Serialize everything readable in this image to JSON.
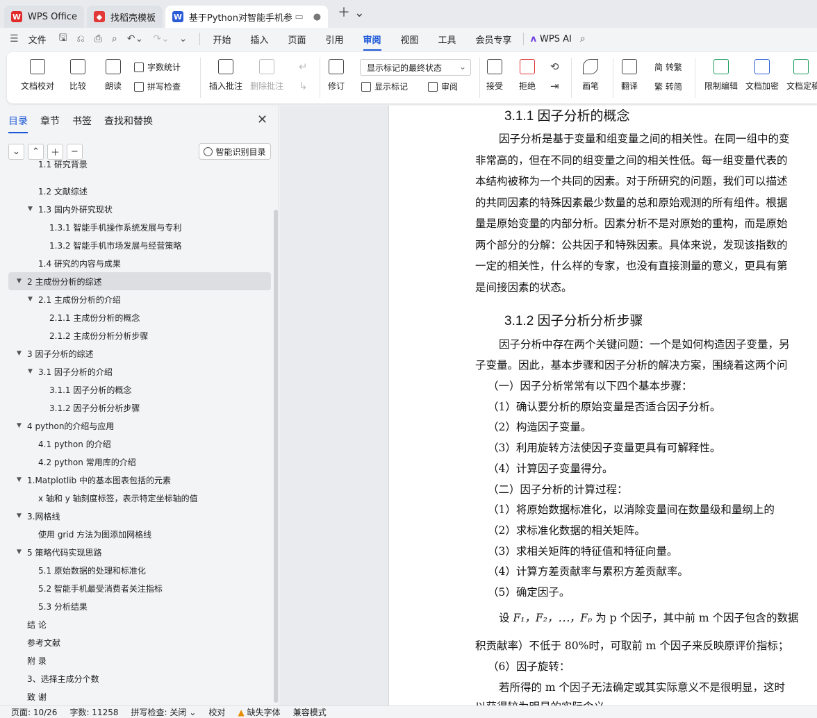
{
  "tabs": [
    {
      "label": "WPS Office",
      "icon": "wps-logo-icon",
      "color": "#e22b2b"
    },
    {
      "label": "找稻壳模板",
      "icon": "docer-icon",
      "color": "#e23838"
    },
    {
      "label": "基于Python对智能手机参数对",
      "icon": "writer-icon",
      "color": "#2a5bd7"
    }
  ],
  "menu": {
    "file": "文件",
    "items": [
      "开始",
      "插入",
      "页面",
      "引用",
      "审阅",
      "视图",
      "工具",
      "会员专享"
    ],
    "active": "审阅",
    "wps_ai": "WPS AI"
  },
  "ribbon": {
    "doc_check": "文档校对",
    "compare": "比较",
    "read_aloud": "朗读",
    "word_count": "字数统计",
    "spell_check": "拼写检查",
    "insert_comment": "插入批注",
    "delete_comment": "删除批注",
    "revise": "修订",
    "markup_display": "显示标记的最终状态",
    "show_markup": "显示标记",
    "review": "审阅",
    "accept": "接受",
    "reject": "拒绝",
    "pen": "画笔",
    "translate": "翻译",
    "to_traditional": "简 转繁",
    "to_simplified": "繁 转简",
    "restrict_edit": "限制编辑",
    "encrypt": "文档加密",
    "finalize": "文档定稿"
  },
  "sidebar": {
    "tabs": [
      "目录",
      "章节",
      "书签",
      "查找和替换"
    ],
    "smart_toc": "智能识别目录",
    "toc": [
      {
        "text": "1.1 研究背景",
        "level": 2,
        "arrow": false,
        "cut": true
      },
      {
        "text": "1.2 文献综述",
        "level": 2,
        "arrow": false
      },
      {
        "text": "1.3 国内外研究现状",
        "level": 2,
        "arrow": true
      },
      {
        "text": "1.3.1 智能手机操作系统发展与专利",
        "level": 3,
        "arrow": false
      },
      {
        "text": "1.3.2 智能手机市场发展与经营策略",
        "level": 3,
        "arrow": false
      },
      {
        "text": "1.4  研究的内容与成果",
        "level": 2,
        "arrow": false
      },
      {
        "text": "2 主成份分析的综述",
        "level": 1,
        "arrow": true,
        "selected": true
      },
      {
        "text": "2.1 主成份分析的介绍",
        "level": 2,
        "arrow": true
      },
      {
        "text": "2.1.1 主成份分析的概念",
        "level": 3,
        "arrow": false
      },
      {
        "text": "2.1.2 主成份分析分析步骤",
        "level": 3,
        "arrow": false
      },
      {
        "text": "3  因子分析的综述",
        "level": 1,
        "arrow": true
      },
      {
        "text": "3.1  因子分析的介绍",
        "level": 2,
        "arrow": true
      },
      {
        "text": "3.1.1  因子分析的概念",
        "level": 3,
        "arrow": false
      },
      {
        "text": "3.1.2 因子分析分析步骤",
        "level": 3,
        "arrow": false
      },
      {
        "text": "4 python的介绍与应用",
        "level": 1,
        "arrow": true
      },
      {
        "text": "4.1 python 的介绍",
        "level": 2,
        "arrow": false
      },
      {
        "text": "4.2 python 常用库的介绍",
        "level": 2,
        "arrow": false
      },
      {
        "text": "1.Matplotlib 中的基本图表包括的元素",
        "level": 1,
        "arrow": true
      },
      {
        "text": "x 轴和 y 轴刻度标签，表示特定坐标轴的值",
        "level": 2,
        "arrow": false
      },
      {
        "text": "3.网格线",
        "level": 1,
        "arrow": true
      },
      {
        "text": "使用 grid 方法为图添加网格线",
        "level": 2,
        "arrow": false
      },
      {
        "text": "5 策略代码实现思路",
        "level": 1,
        "arrow": true
      },
      {
        "text": "5.1  原始数据的处理和标准化",
        "level": 2,
        "arrow": false
      },
      {
        "text": "5.2  智能手机最受消费者关注指标",
        "level": 2,
        "arrow": false
      },
      {
        "text": "5.3  分析结果",
        "level": 2,
        "arrow": false
      },
      {
        "text": "结  论",
        "level": 1,
        "arrow": false
      },
      {
        "text": "参考文献",
        "level": 1,
        "arrow": false
      },
      {
        "text": "附  录",
        "level": 1,
        "arrow": false
      },
      {
        "text": "3、选择主成分个数",
        "level": 1,
        "arrow": false
      },
      {
        "text": "致  谢",
        "level": 1,
        "arrow": false
      }
    ]
  },
  "document": {
    "heading1": "3.1.1  因子分析的概念",
    "para1": [
      "因子分析是基于变量和组变量之间的相关性。在同一组中的变",
      "非常高的，但在不同的组变量之间的相关性低。每一组变量代表的",
      "本结构被称为一个共同的因素。对于所研究的问题，我们可以描述",
      "的共同因素的特殊因素最少数量的总和原始观测的所有组件。根据",
      "量是原始变量的内部分析。因素分析不是对原始的重构，而是原始",
      "两个部分的分解：公共因子和特殊因素。具体来说，发现该指数的",
      "一定的相关性，什么样的专家，也没有直接测量的意义，更具有第",
      "是间接因素的状态。"
    ],
    "heading2": "3.1.2 因子分析分析步骤",
    "para2": [
      "因子分析中存在两个关键问题：一个是如何构造因子变量，另",
      "子变量。因此，基本步骤和因子分析的解决方案，围绕着这两个问"
    ],
    "steps": [
      "（一）因子分析常常有以下四个基本步骤：",
      "（1）确认要分析的原始变量是否适合因子分析。",
      "（2）构造因子变量。",
      "（3）利用旋转方法使因子变量更具有可解释性。",
      "（4）计算因子变量得分。",
      "（二）因子分析的计算过程：",
      "（1）将原始数据标准化，以消除变量间在数量级和量纲上的",
      "（2）求标准化数据的相关矩阵。",
      "（3）求相关矩阵的特征值和特征向量。",
      "（4）计算方差贡献率与累积方差贡献率。",
      "（5）确定因子。"
    ],
    "formula_prefix": "设",
    "formula": "F₁，F₂，⋯，Fₚ",
    "formula_suffix": "为 p 个因子，其中前 m 个因子包含的数据",
    "line_after": "积贡献率）不低于 80%时，可取前 m 个因子来反映原评价指标；",
    "step6": "（6）因子旋转：",
    "last": "若所得的 m 个因子无法确定或其实际意义不是很明显，这时",
    "last_cut": "以获得较为明显的实际含义。"
  },
  "status": {
    "page": "页面: 10/26",
    "words": "字数: 11258",
    "spell": "拼写检查: 关闭",
    "proof": "校对",
    "missing_font": "缺失字体",
    "compat": "兼容模式"
  }
}
